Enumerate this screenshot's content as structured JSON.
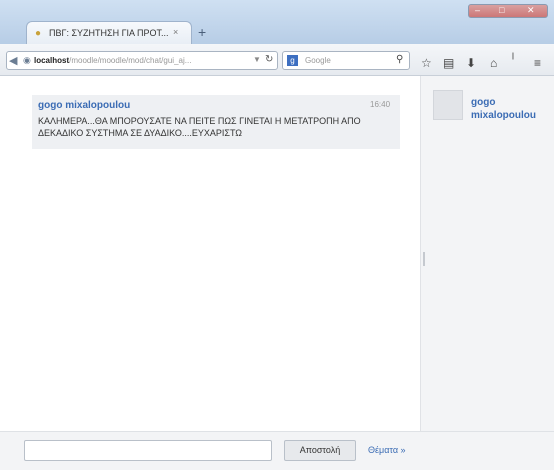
{
  "browser": {
    "tab_title": "ΠΒΓ: ΣΥΖΗΤΗΣΗ ΓΙΑ ΠΡΟΤ...",
    "tab_close": "×",
    "new_tab": "+",
    "url_host": "localhost",
    "url_path": "/moodle/moodle/mod/chat/gui_aj...",
    "search_placeholder": "Google"
  },
  "chat": {
    "messages": [
      {
        "author": "gogo mixalopoulou",
        "time": "16:40",
        "text": "ΚΑΛΗΜΕΡΑ...ΘΑ ΜΠΟΡΟΥΣΑΤΕ ΝΑ ΠΕΙΤΕ ΠΩΣ ΓΙΝΕΤΑΙ Η ΜΕΤΑΤΡΟΠΗ ΑΠΟ ΔΕΚΑΔΙΚΟ ΣΥΣΤΗΜΑ ΣΕ ΔΥΑΔΙΚΟ....ΕΥΧΑΡΙΣΤΩ"
      }
    ]
  },
  "users": [
    {
      "name": "gogo mixalopoulou"
    }
  ],
  "bottom": {
    "input_value": "",
    "send_label": "Αποστολή",
    "theme_label": "Θέματα »"
  },
  "colors": {
    "link": "#3b6cb4",
    "message_bg": "#eef0f3",
    "sidebar_bg": "#f3f4f6"
  }
}
